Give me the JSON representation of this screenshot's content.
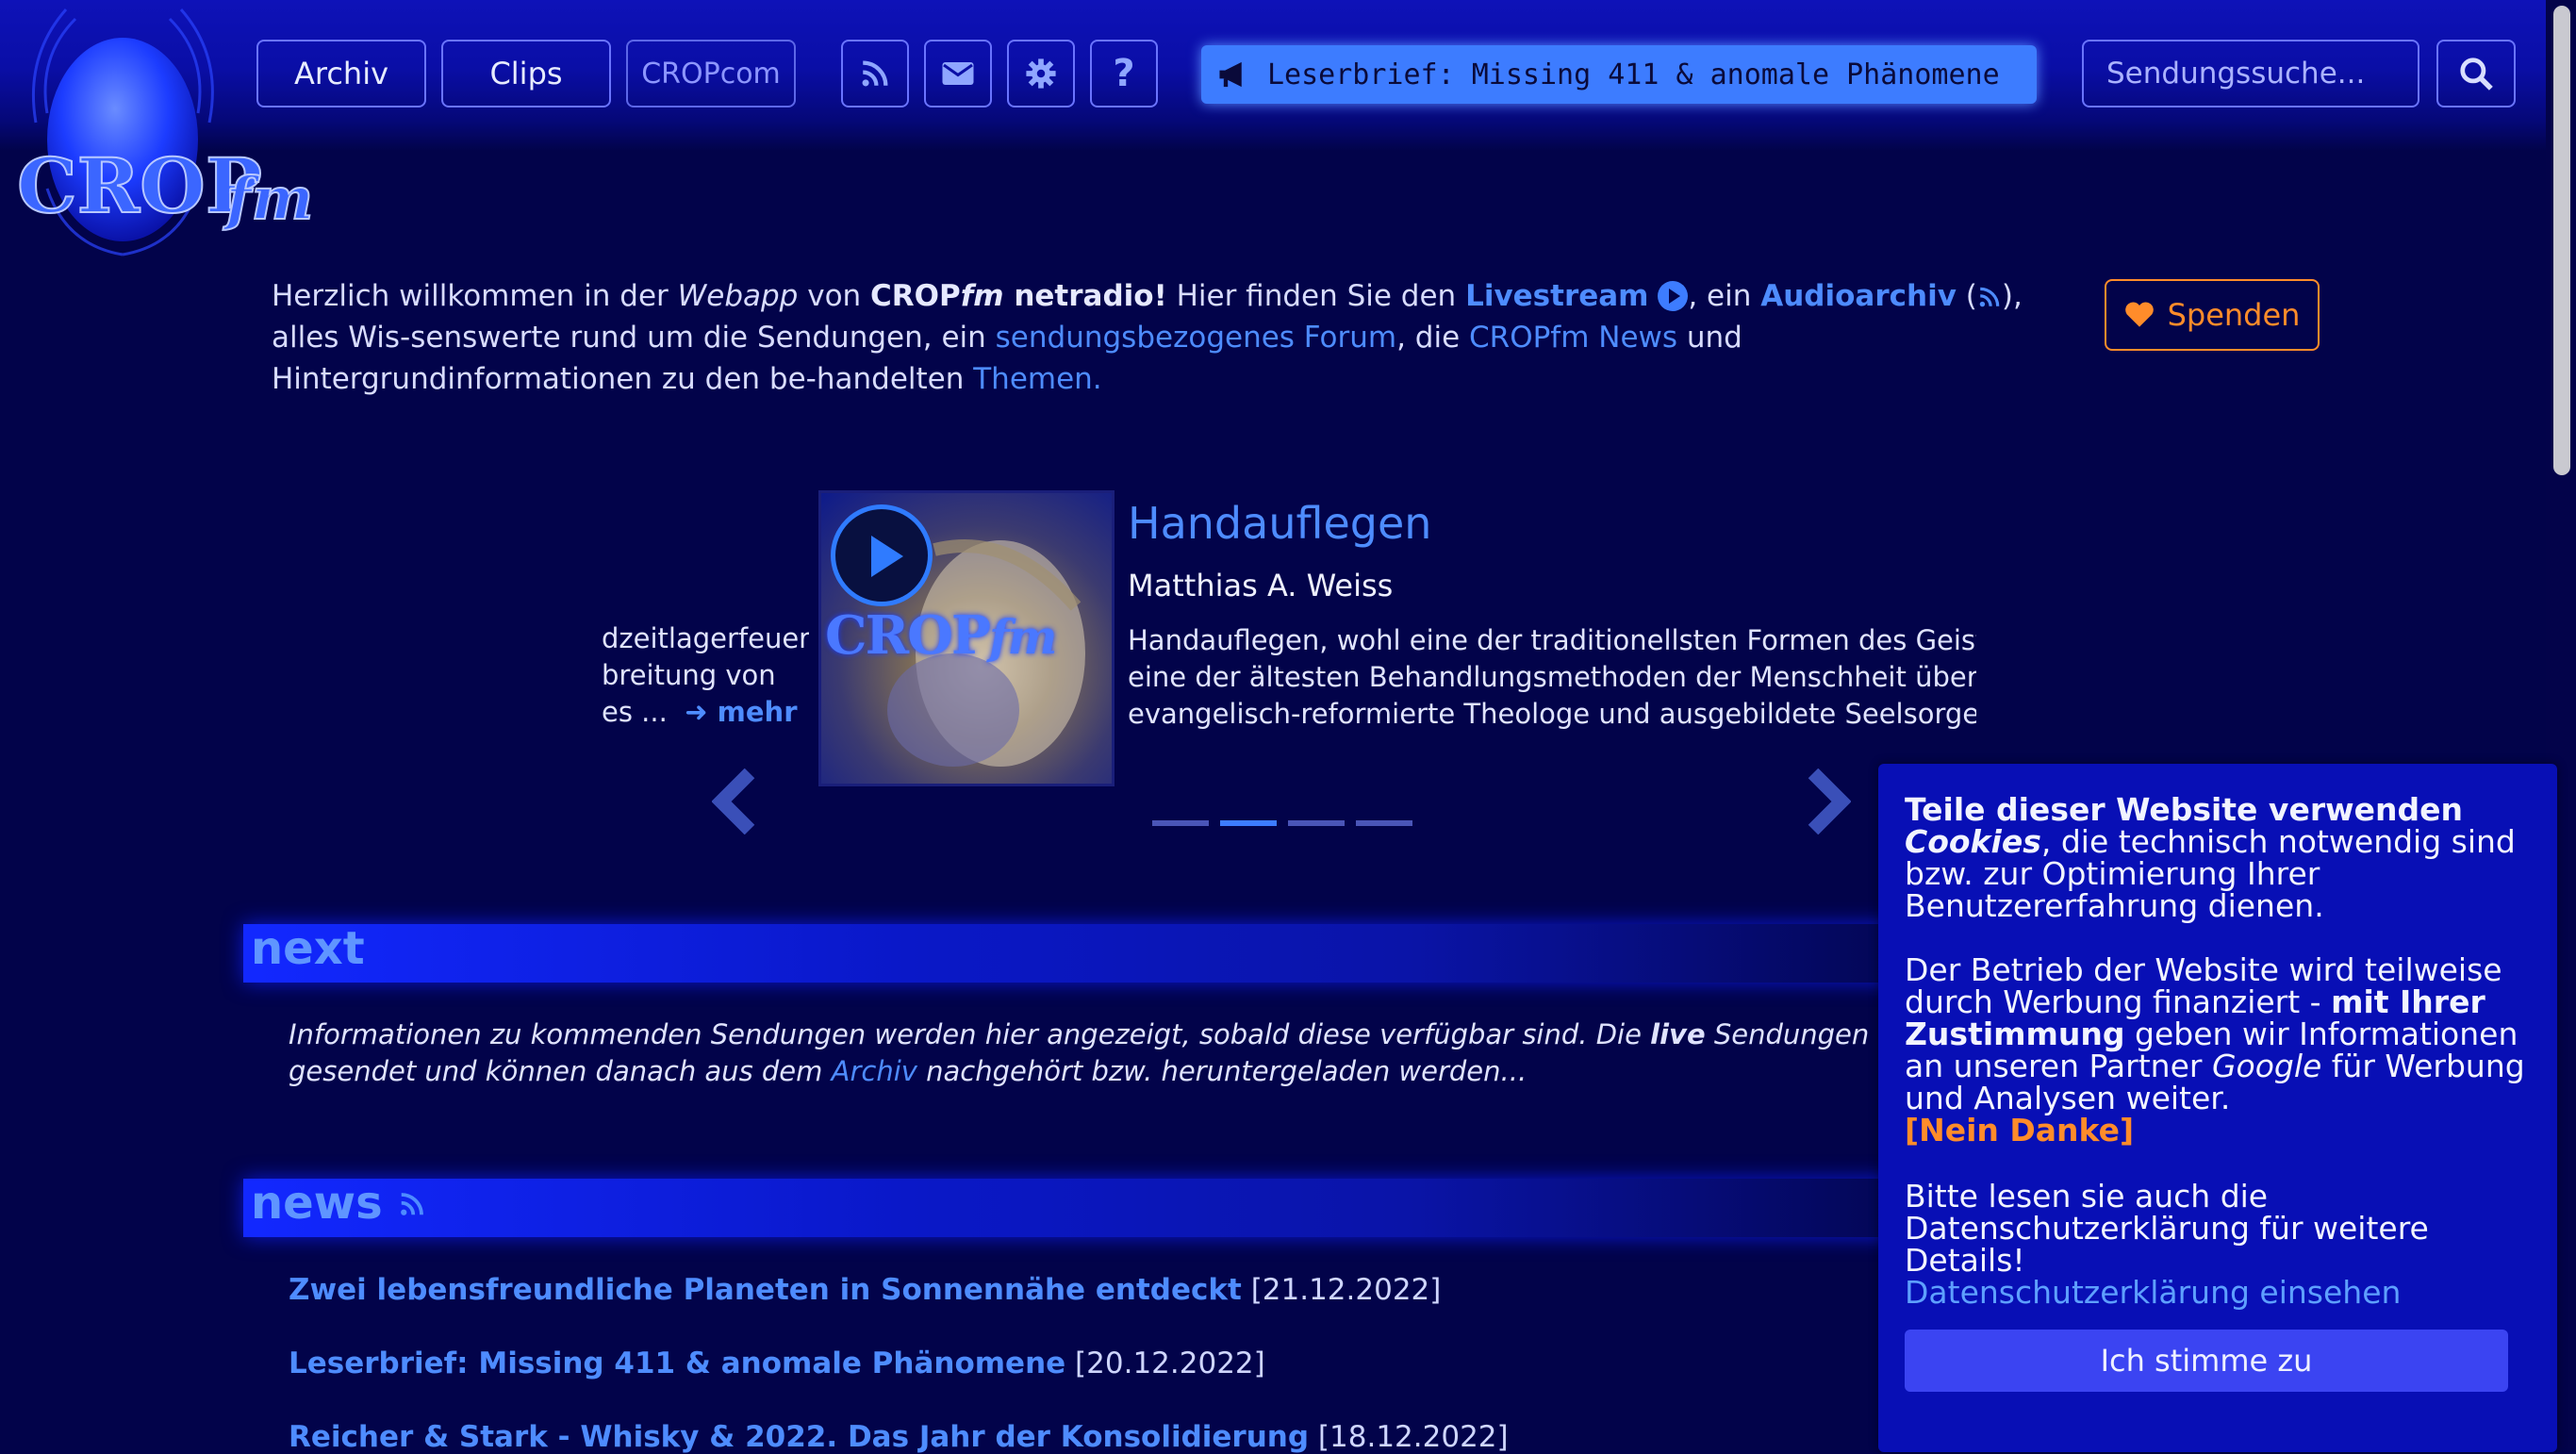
{
  "brand": {
    "name": "CROPfm"
  },
  "nav": {
    "archiv": "Archiv",
    "clips": "Clips",
    "cropcom": "CROPcom",
    "icons": [
      "rss-icon",
      "envelope-icon",
      "gear-icon",
      "question-icon"
    ]
  },
  "ticker": {
    "text": "Leserbrief: Missing 411 & anomale Phänomene"
  },
  "search": {
    "placeholder": "Sendungssuche..."
  },
  "intro": {
    "p1": "Herzlich willkommen in der ",
    "webapp": "Webapp",
    "p2": " von ",
    "brand_a": "CROP",
    "brand_b": "fm",
    "brand_c": " netradio!",
    "p3": " Hier finden Sie den ",
    "livestream": "Livestream",
    "p4": ", ein ",
    "audioarchiv": "Audioarchiv",
    "p5a": " (",
    "p5b": "), alles Wis-senswerte rund um die Sendungen, ein ",
    "forum": "sendungsbezogenes Forum",
    "p6": ", die ",
    "news": "CROPfm News",
    "p7": " und Hintergrundinformationen zu den be-handelten ",
    "themen": "Themen."
  },
  "donate": {
    "label": "Spenden"
  },
  "carousel": {
    "prev_lines": [
      "dzeitlagerfeuer\",",
      "breitung von",
      "es ..."
    ],
    "prev_more": "mehr",
    "title": "Handauflegen",
    "author": "Matthias A. Weiss",
    "desc_lines": [
      "Handauflegen, wohl eine der traditionellsten Formen des Geistigen",
      "eine der ältesten Behandlungsmethoden der Menschheit überhaup",
      "evangelisch-reformierte Theologe und ausgebildete Seelsorger ..."
    ],
    "slide_count": 4,
    "active_slide": 2
  },
  "next": {
    "title": "next",
    "text_a": "Informationen zu kommenden Sendungen werden hier angezeigt, sobald diese verfügbar sind. Die ",
    "live": "live",
    "text_b": " Sendungen werden in d",
    "text_c": "gesendet und können danach aus dem ",
    "archiv_link": "Archiv",
    "text_d": " nachgehört bzw. heruntergeladen werden..."
  },
  "news": {
    "title": "news",
    "items": [
      {
        "title": "Zwei lebensfreundliche Planeten in Sonnennähe entdeckt",
        "date": "[21.12.2022]"
      },
      {
        "title": "Leserbrief: Missing 411 & anomale Phänomene",
        "date": "[20.12.2022]"
      },
      {
        "title": "Reicher & Stark - Whisky & 2022. Das Jahr der Konsolidierung",
        "date": "[18.12.2022]"
      }
    ]
  },
  "cookie": {
    "h1": "Teile dieser Website verwenden",
    "cookies": "Cookies",
    "h2": ", die technisch notwendig sind bzw. zur Optimierung Ihrer Benutzererfahrung dienen.",
    "p2a": "Der Betrieb der Website wird teilweise durch Werbung finanziert - ",
    "p2b": "mit Ihrer Zustimmung",
    "p2c": " geben wir Informationen an unseren Partner ",
    "google": "Google",
    "p2d": " für Werbung und Analysen weiter.",
    "decline": "[Nein Danke]",
    "p3": "Bitte lesen sie auch die Datenschutzerklärung für weitere Details!",
    "privacy_link": "Datenschutzerklärung einsehen",
    "accept": "Ich stimme zu"
  },
  "colors": {
    "accent": "#4e8cff",
    "donate": "#ff8c2a",
    "background": "#02034a"
  }
}
